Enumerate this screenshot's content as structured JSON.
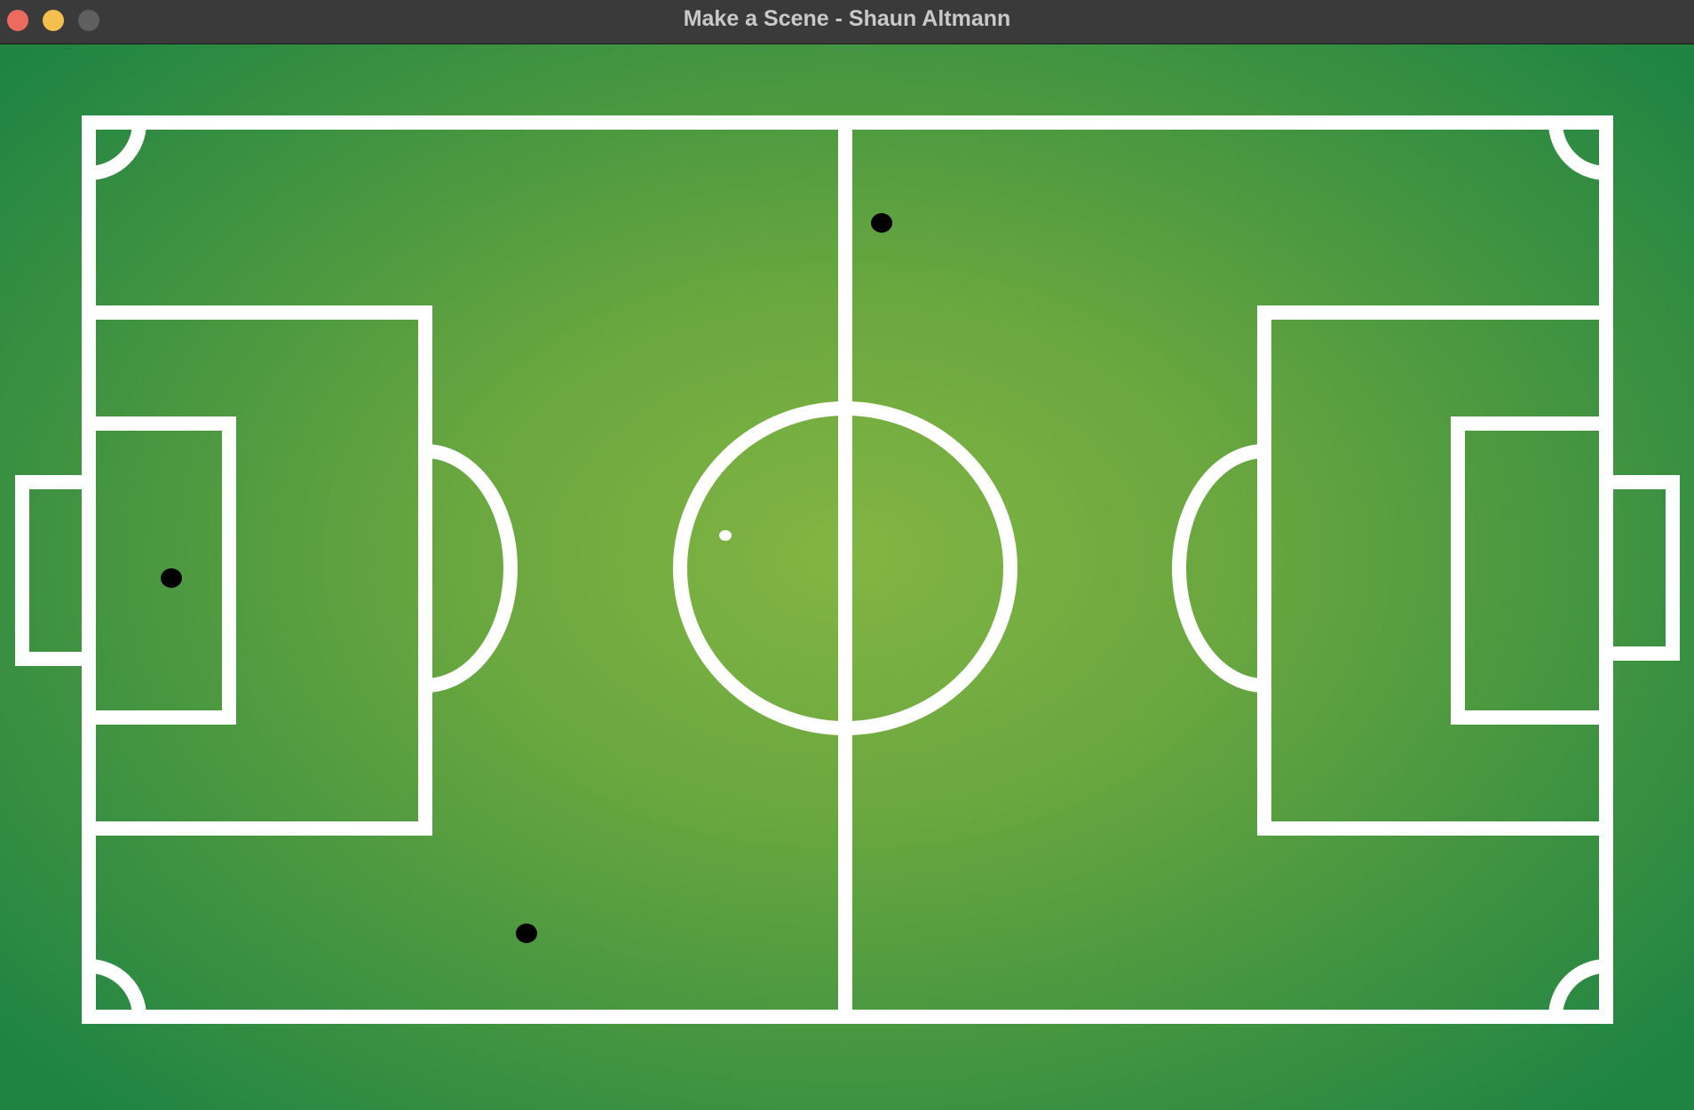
{
  "window": {
    "title": "Make a Scene - Shaun Altmann",
    "controls": {
      "close_color": "#ed6a5e",
      "minimize_color": "#f5bf4f",
      "zoom_color": "#5f5f5f"
    }
  },
  "scene": {
    "line_color": "#ffffff",
    "player_color": "#000000",
    "ball_color": "#ffffff",
    "player_count": 3
  }
}
